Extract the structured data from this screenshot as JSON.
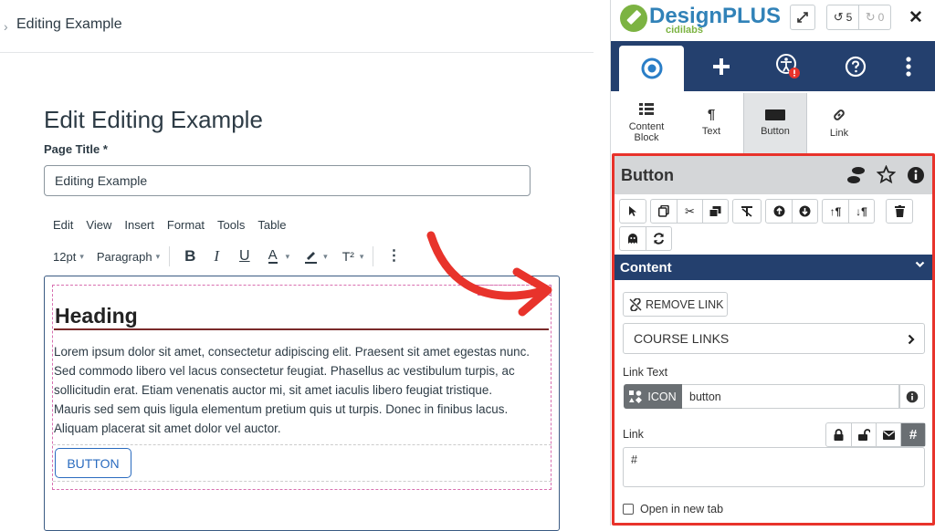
{
  "breadcrumb": {
    "current": "Editing Example"
  },
  "page": {
    "heading": "Edit Editing Example",
    "title_label": "Page Title",
    "title_required": "*",
    "title_value": "Editing Example"
  },
  "editor": {
    "menu": [
      "Edit",
      "View",
      "Insert",
      "Format",
      "Tools",
      "Table"
    ],
    "font_size": "12pt",
    "block_format": "Paragraph",
    "superscript_label": "T²",
    "content_heading": "Heading",
    "paragraph_lines": [
      "Lorem ipsum dolor sit amet, consectetur adipiscing elit. Praesent sit amet egestas nunc.",
      "Sed commodo libero vel lacus consectetur feugiat. Phasellus ac vestibulum turpis, ac",
      "sollicitudin erat. Etiam venenatis auctor mi, sit amet iaculis libero feugiat tristique.",
      "Mauris sed sem quis ligula elementum pretium quis ut turpis. Donec in finibus lacus.",
      "Aliquam placerat sit amet dolor vel auctor."
    ],
    "button_label": "BUTTON"
  },
  "panel": {
    "logo_main": "DesignPLUS",
    "logo_sub": "cidilabs",
    "undo_count": "5",
    "redo_count": "0",
    "sub_tabs": [
      {
        "label": "Content Block"
      },
      {
        "label": "Text"
      },
      {
        "label": "Button"
      },
      {
        "label": "Link"
      }
    ],
    "element_title": "Button",
    "content_section": "Content",
    "remove_link": "REMOVE LINK",
    "course_links": "COURSE LINKS",
    "link_text_label": "Link Text",
    "icon_chip": "ICON",
    "link_text_value": "button",
    "link_label": "Link",
    "link_value": "#",
    "new_tab_label": "Open in new tab"
  },
  "colors": {
    "nav_bg": "#24406e",
    "highlight_red": "#e8332b",
    "button_blue": "#2a6bbf",
    "logo_blue": "#3182b8",
    "logo_green": "#7cb342"
  }
}
